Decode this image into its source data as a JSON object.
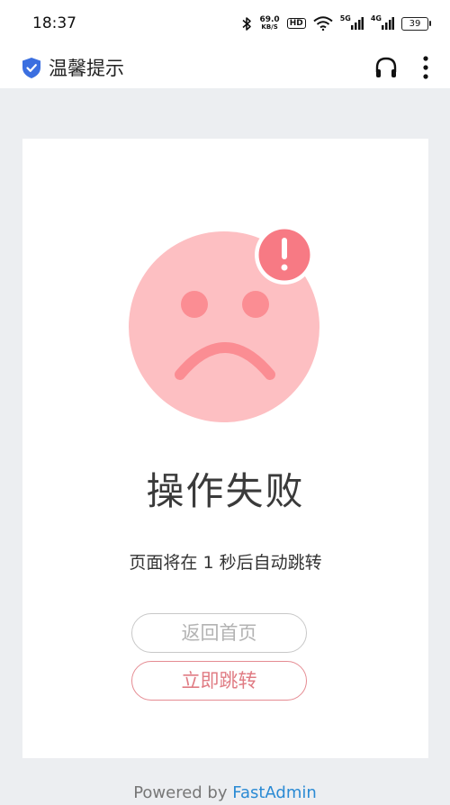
{
  "status_bar": {
    "time": "18:37",
    "net_speed_value": "69.0",
    "net_speed_unit": "KB/S",
    "hd_label": "HD",
    "net_5g_label": "5G",
    "net_4g_label": "4G",
    "battery_level": "39",
    "icons": [
      "bluetooth-icon",
      "wifi-icon",
      "signal-icon",
      "battery-icon"
    ]
  },
  "title_bar": {
    "title": "温馨提示",
    "icons": [
      "shield-check-icon",
      "headphones-icon",
      "more-vertical-icon"
    ]
  },
  "result": {
    "icon": "sad-face-alert-icon",
    "title": "操作失败",
    "message": "页面将在 1 秒后自动跳转",
    "home_button": "返回首页",
    "jump_button": "立即跳转"
  },
  "footer": {
    "prefix": "Powered by ",
    "link": "FastAdmin"
  },
  "colors": {
    "face": "#fdbfc2",
    "face_features": "#fb8d93",
    "alert": "#f77a84",
    "accent_link": "#2a8ad4"
  }
}
